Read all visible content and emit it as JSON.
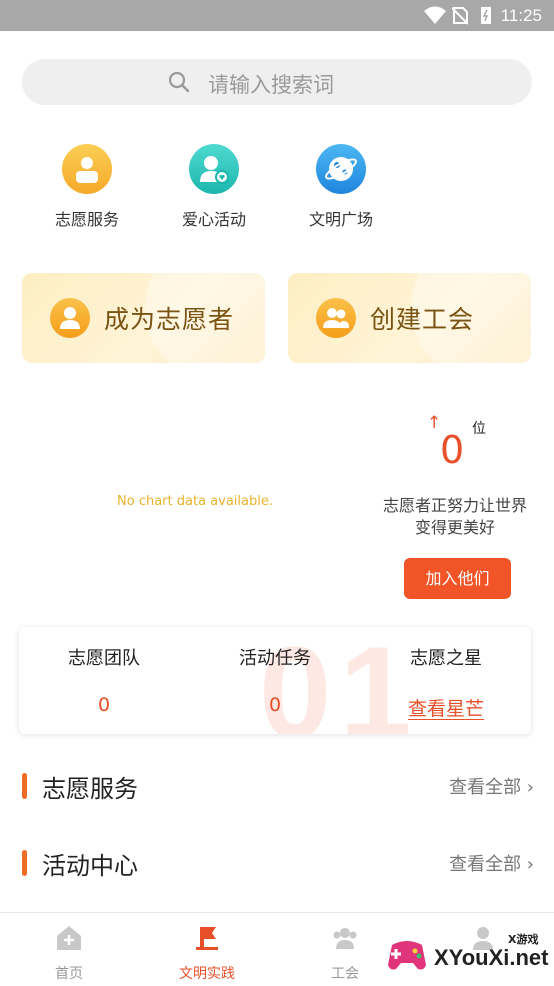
{
  "status_bar": {
    "time": "11:25"
  },
  "search": {
    "placeholder": "请输入搜索词"
  },
  "categories": [
    {
      "label": "志愿服务",
      "icon": "volunteer-service-icon",
      "color": "#f6b62e"
    },
    {
      "label": "爱心活动",
      "icon": "love-activity-icon",
      "color": "#2cc8bf"
    },
    {
      "label": "文明广场",
      "icon": "civilization-square-icon",
      "color": "#2a9be8"
    }
  ],
  "cards": {
    "become_volunteer": "成为志愿者",
    "create_union": "创建工会"
  },
  "chart": {
    "empty_message": "No chart data available."
  },
  "ranking": {
    "arrow": "↑",
    "value": "0",
    "unit": "位",
    "message": "志愿者正努力让世界变得更美好",
    "join_label": "加入他们"
  },
  "stats": {
    "watermark": "01",
    "team_label": "志愿团队",
    "team_value": "0",
    "task_label": "活动任务",
    "task_value": "0",
    "star_label": "志愿之星",
    "star_link": "查看星芒"
  },
  "sections": [
    {
      "title": "志愿服务",
      "more": "查看全部"
    },
    {
      "title": "活动中心",
      "more": "查看全部"
    }
  ],
  "tabs": [
    {
      "label": "首页",
      "icon": "home-icon",
      "active": false
    },
    {
      "label": "文明实践",
      "icon": "flag-icon",
      "active": true
    },
    {
      "label": "工会",
      "icon": "group-icon",
      "active": false
    },
    {
      "label": "",
      "icon": "profile-icon",
      "active": false
    }
  ],
  "watermark": {
    "brand": "XYouXi.net",
    "small": "X游戏"
  },
  "colors": {
    "accent": "#e8502a",
    "button": "#f05427",
    "card_text": "#7a5313"
  }
}
